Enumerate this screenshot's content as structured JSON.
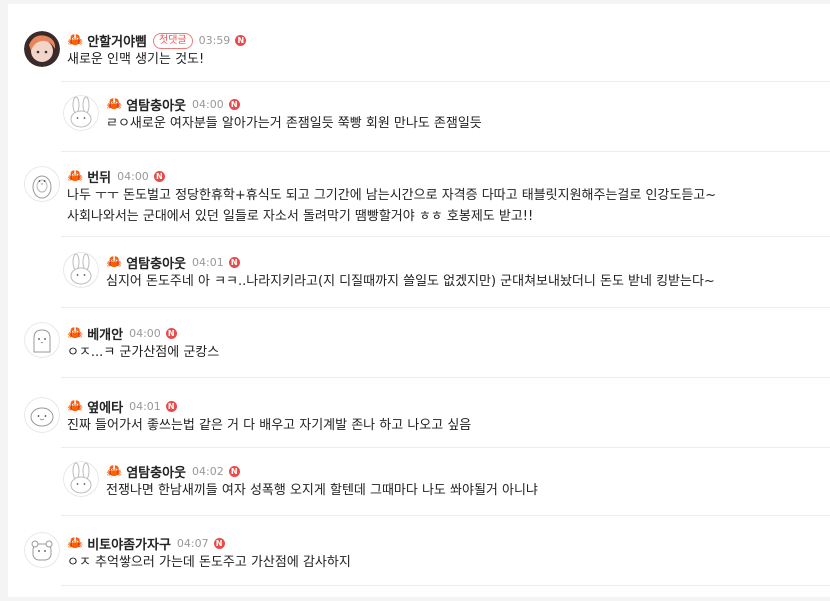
{
  "comments": [
    {
      "nick": "안할거야삠",
      "badge": "첫댓글",
      "time": "03:59",
      "n": "N",
      "lines": [
        "새로운 인맥 생기는 것도!"
      ]
    },
    {
      "nick": "염탐충아웃",
      "time": "04:00",
      "n": "N",
      "lines": [
        "ㄹㅇ새로운 여자분들 알아가는거 존잼일듯 쭉빵 회원 만나도 존잼일듯"
      ]
    },
    {
      "nick": "번뒤",
      "time": "04:00",
      "n": "N",
      "lines": [
        "나두 ㅜㅜ 돈도벌고 정당한휴학+휴식도 되고 그기간에 남는시간으로 자격증 다따고 태블릿지원해주는걸로 인강도듣고~",
        "사회나와서는 군대에서 있던 일들로 자소서 돌려막기 땜빵할거야 ㅎㅎ 호봉제도 받고!!"
      ]
    },
    {
      "nick": "염탐충아웃",
      "time": "04:01",
      "n": "N",
      "lines": [
        "심지어 돈도주네 아 ㅋㅋ..나라지키라고(지 디질때까지 쓸일도 없겠지만) 군대쳐보내놨더니 돈도 받네 킹받는다~"
      ]
    },
    {
      "nick": "베개안",
      "time": "04:00",
      "n": "N",
      "lines": [
        "ㅇㅈ...ㅋ 군가산점에 군캉스"
      ]
    },
    {
      "nick": "옆에타",
      "time": "04:01",
      "n": "N",
      "lines": [
        "진짜 들어가서 좋쓰는법 같은 거 다 배우고 자기계발 존나 하고 나오고 싶음"
      ]
    },
    {
      "nick": "염탐충아웃",
      "time": "04:02",
      "n": "N",
      "lines": [
        "전쟁나면 한남새끼들 여자 성폭행 오지게 할텐데 그때마다 나도 쏴야될거 아니냐"
      ]
    },
    {
      "nick": "비토야좀가자구",
      "time": "04:07",
      "n": "N",
      "lines": [
        "ㅇㅈ 추억쌓으러 가는데 돈도주고 가산점에 감사하지"
      ]
    }
  ],
  "colors": {
    "crab": "#d6382d",
    "badge": "#e94a4a",
    "time": "#999999"
  },
  "icons": {
    "crab": "🦀"
  }
}
